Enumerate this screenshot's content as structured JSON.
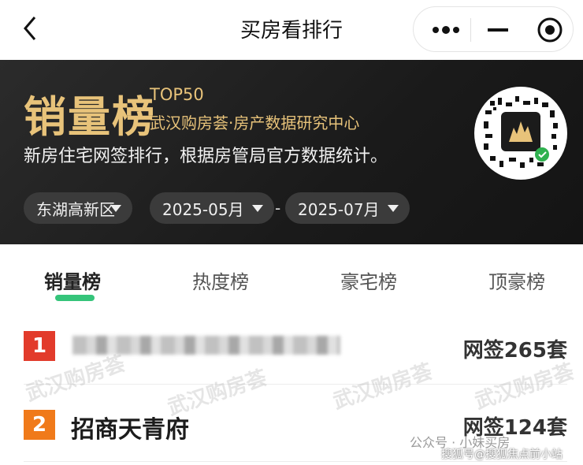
{
  "navbar": {
    "title": "买房看排行",
    "back_icon": "chevron-left-icon",
    "capsule": {
      "more_icon": "more-dots-icon",
      "minimize_icon": "minimize-icon",
      "close_icon": "target-circle-icon"
    }
  },
  "hero": {
    "title": "销量榜",
    "badge": "TOP50",
    "org": "武汉购房荟·房产数据研究中心",
    "description": "新房住宅网签排行，根据房管局官方数据统计。",
    "filters": {
      "district": "东湖高新区",
      "start_month": "2025-05月",
      "separator": "-",
      "end_month": "2025-07月"
    },
    "qr_label": "武汉购房荟",
    "accent": "#e8c37a",
    "bg": "#1e1e1e"
  },
  "tabs": [
    {
      "label": "销量榜",
      "active": true
    },
    {
      "label": "热度榜",
      "active": false
    },
    {
      "label": "豪宅榜",
      "active": false
    },
    {
      "label": "顶豪榜",
      "active": false
    }
  ],
  "tab_accent": "#35c47a",
  "list": [
    {
      "rank": "1",
      "name": "",
      "count": "网签265套",
      "color": "#e23b2b"
    },
    {
      "rank": "2",
      "name": "招商天青府",
      "count": "网签124套",
      "color": "#f07a1a"
    }
  ],
  "watermarks": [
    "武汉购房荟",
    "武汉购房荟",
    "武汉购房荟",
    "武汉购房荟"
  ],
  "footer": {
    "account": "公众号 · 小妹买房",
    "source": "搜狐号@搜狐焦点前小站"
  }
}
